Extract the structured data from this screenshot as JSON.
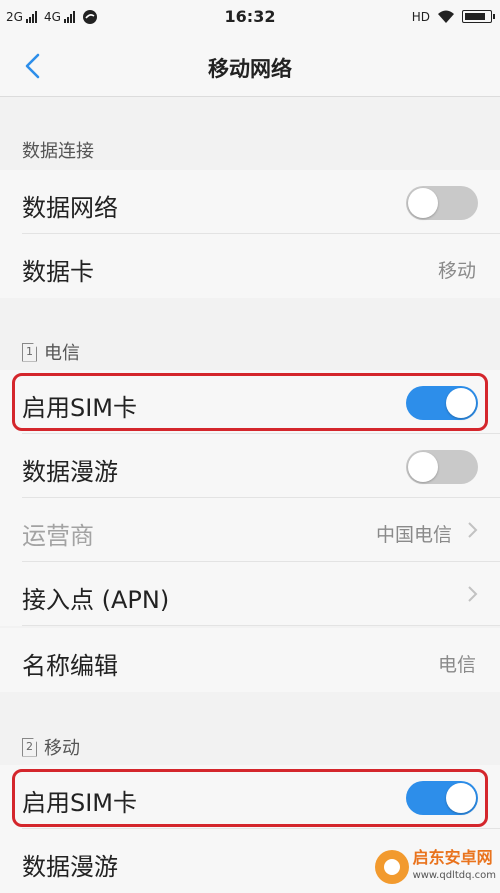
{
  "status_bar": {
    "network1": "2G",
    "network2": "4G",
    "time": "16:32",
    "hd": "HD",
    "battery_level": 0.85
  },
  "nav": {
    "back_icon": "chevron-left-icon",
    "title": "移动网络"
  },
  "data_connection": {
    "header": "数据连接",
    "data_network": {
      "label": "数据网络",
      "enabled": false
    },
    "data_card": {
      "label": "数据卡",
      "value": "移动"
    }
  },
  "sim1": {
    "slot": "1",
    "header": "电信",
    "enable_sim": {
      "label": "启用SIM卡",
      "enabled": true
    },
    "data_roaming": {
      "label": "数据漫游",
      "enabled": false
    },
    "carrier": {
      "label": "运营商",
      "value": "中国电信"
    },
    "apn": {
      "label": "接入点 (APN)"
    },
    "name_edit": {
      "label": "名称编辑",
      "value": "电信"
    }
  },
  "sim2": {
    "slot": "2",
    "header": "移动",
    "enable_sim": {
      "label": "启用SIM卡",
      "enabled": true
    },
    "data_roaming": {
      "label": "数据漫游"
    }
  },
  "watermark": {
    "name": "启东安卓网",
    "url": "www.qdltdq.com"
  },
  "colors": {
    "accent": "#2d8eea",
    "highlight": "#d4262c",
    "background": "#f2f2f2",
    "row": "#f7f7f7"
  }
}
